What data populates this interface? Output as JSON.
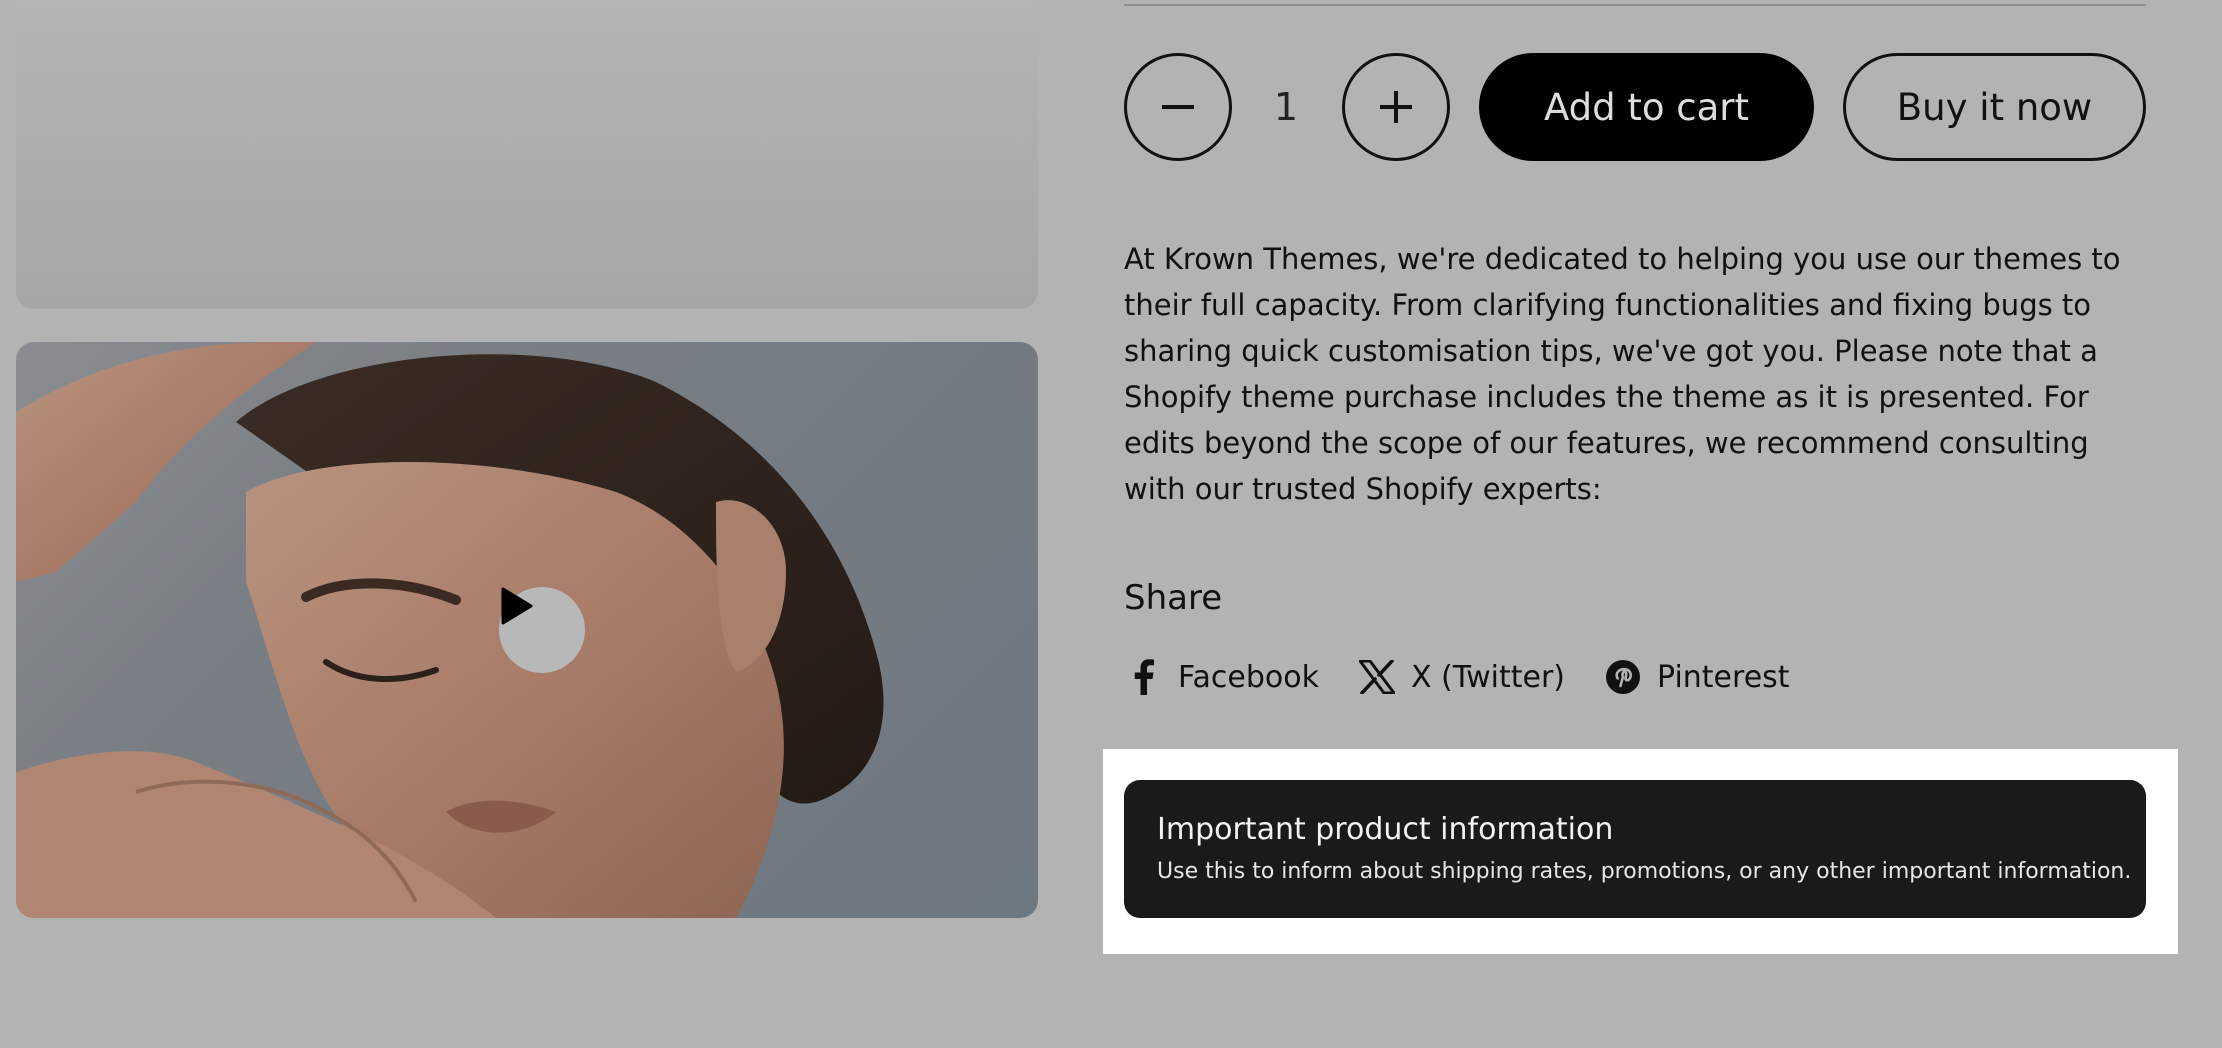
{
  "product": {
    "quantity": "1",
    "add_to_cart_label": "Add to cart",
    "buy_now_label": "Buy it now",
    "description": "At Krown Themes, we're dedicated to helping you use our themes to their full capacity. From clarifying functionalities and fixing bugs to sharing quick customisation tips, we've got you. Please note that a Shopify theme purchase includes the theme as it is presented. For edits beyond the scope of our features, we recommend consulting with our trusted Shopify experts:"
  },
  "share": {
    "heading": "Share",
    "links": [
      {
        "label": "Facebook",
        "icon": "facebook-icon"
      },
      {
        "label": "X (Twitter)",
        "icon": "x-twitter-icon"
      },
      {
        "label": "Pinterest",
        "icon": "pinterest-icon"
      }
    ]
  },
  "info_block": {
    "title": "Important product information",
    "text": "Use this to inform about shipping rates, promotions, or any other important information."
  },
  "media": {
    "video_play_icon": "play-icon"
  },
  "colors": {
    "overlay_background": "#b3b3b3",
    "button_primary": "#000000",
    "info_box": "#1a1a1a",
    "highlight": "#ffffff"
  }
}
